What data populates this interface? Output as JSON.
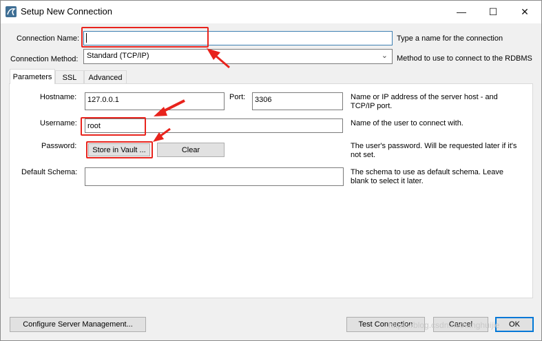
{
  "window": {
    "title": "Setup New Connection",
    "controls": {
      "minimize": "—",
      "maximize": "☐",
      "close": "✕"
    }
  },
  "form": {
    "connection_name": {
      "label": "Connection Name:",
      "value": "",
      "help": "Type a name for the connection"
    },
    "connection_method": {
      "label": "Connection Method:",
      "value": "Standard (TCP/IP)",
      "help": "Method to use to connect to the RDBMS"
    }
  },
  "tabs": [
    {
      "label": "Parameters",
      "active": true
    },
    {
      "label": "SSL",
      "active": false
    },
    {
      "label": "Advanced",
      "active": false
    }
  ],
  "parameters": {
    "hostname": {
      "label": "Hostname:",
      "value": "127.0.0.1"
    },
    "port": {
      "label": "Port:",
      "value": "3306"
    },
    "host_help": "Name or IP address of the server host - and TCP/IP port.",
    "username": {
      "label": "Username:",
      "value": "root",
      "help": "Name of the user to connect with."
    },
    "password": {
      "label": "Password:",
      "store_button": "Store in Vault ...",
      "clear_button": "Clear",
      "help": "The user's password. Will be requested later if it's not set."
    },
    "default_schema": {
      "label": "Default Schema:",
      "value": "",
      "help": "The schema to use as default schema. Leave blank to select it later."
    }
  },
  "footer": {
    "configure_button": "Configure Server Management...",
    "test_button": "Test Connection",
    "cancel_button": "Cancel",
    "ok_button": "OK"
  },
  "annotation": {
    "accent_color": "#e8231c"
  },
  "watermark": "https://blog.csdn.net/ianghuijie"
}
